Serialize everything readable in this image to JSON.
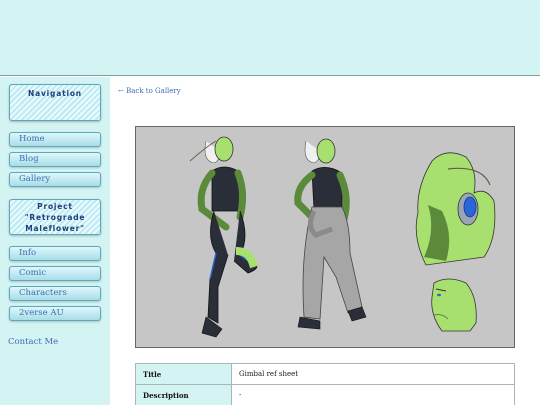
{
  "sidebar": {
    "nav_heading": "Navigation",
    "nav_items": [
      {
        "label": "Home"
      },
      {
        "label": "Blog"
      },
      {
        "label": "Gallery"
      }
    ],
    "project_heading": "Project \"Retrograde Maleflower\"",
    "project_items": [
      {
        "label": "Info"
      },
      {
        "label": "Comic"
      },
      {
        "label": "Characters"
      },
      {
        "label": "2verse AU"
      }
    ],
    "contact_label": "Contact Me"
  },
  "main": {
    "back_label": "← Back to Gallery",
    "image_name": "character-reference-sheet",
    "details": [
      {
        "key": "Title",
        "value": "Gimbal ref sheet"
      },
      {
        "key": "Description",
        "value": "-"
      }
    ]
  },
  "colors": {
    "banner_bg": "#d4f3f3",
    "link": "#3d6fb3",
    "skin": "#a8e070",
    "suit": "#2a2e38"
  }
}
